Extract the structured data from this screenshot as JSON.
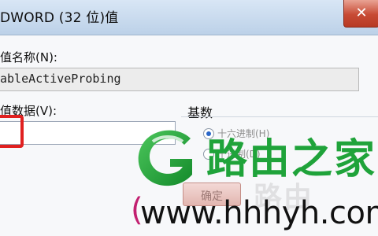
{
  "dialog": {
    "title": "DWORD (32 位)值",
    "close_glyph": "✕"
  },
  "form": {
    "name_label": "值名称(N):",
    "name_value": "ableActiveProbing",
    "data_label": "值数据(V):",
    "data_value": "",
    "base_label": "基数",
    "radix_options": [
      {
        "label": "十六进制(H)",
        "selected": true
      },
      {
        "label": "十进制(D)",
        "selected": false
      }
    ],
    "ok_label": "确定"
  },
  "watermark": {
    "brand_text": "路由之家",
    "faded_text": "路由",
    "url_text": "www.hhhyh.com",
    "paren": "(",
    "brand_color": "#1fa33a"
  },
  "colors": {
    "highlight_box": "#e02020",
    "title_bar": "#bcd1e8"
  }
}
